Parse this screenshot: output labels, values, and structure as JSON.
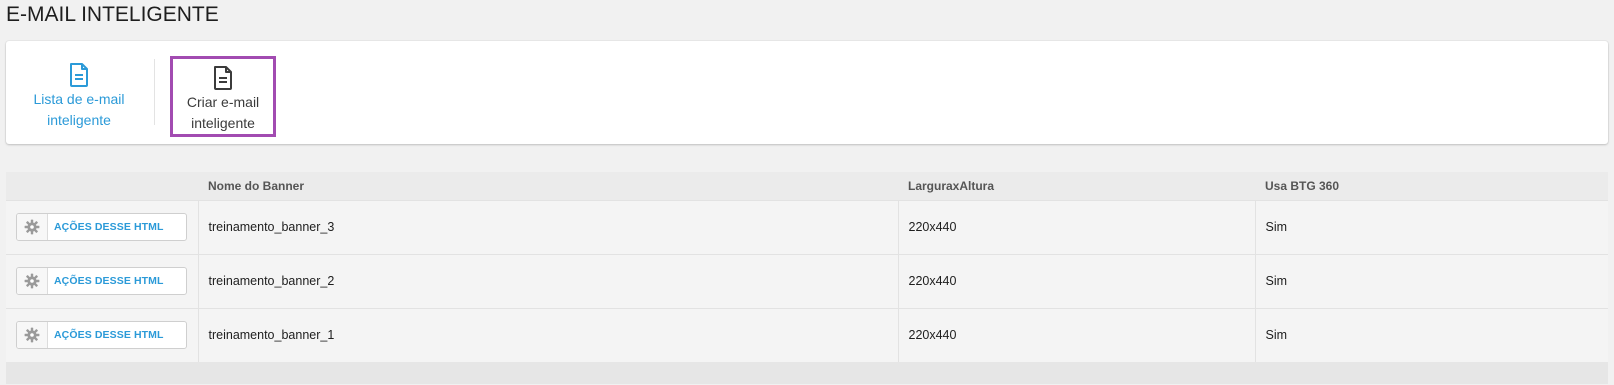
{
  "page": {
    "title": "E-MAIL INTELIGENTE"
  },
  "toolbar": {
    "list": {
      "label": "Lista de e-mail inteligente",
      "icon": "document-icon",
      "color": "#2b9ad8"
    },
    "create": {
      "label": "Criar e-mail inteligente",
      "icon": "document-icon",
      "highlight_color": "#a24bb1"
    }
  },
  "table": {
    "headers": [
      "",
      "Nome do Banner",
      "LarguraxAltura",
      "Usa BTG 360"
    ],
    "action_label": "AÇÕES DESSE HTML",
    "rows": [
      {
        "name": "treinamento_banner_3",
        "size": "220x440",
        "btg": "Sim"
      },
      {
        "name": "treinamento_banner_2",
        "size": "220x440",
        "btg": "Sim"
      },
      {
        "name": "treinamento_banner_1",
        "size": "220x440",
        "btg": "Sim"
      }
    ]
  }
}
